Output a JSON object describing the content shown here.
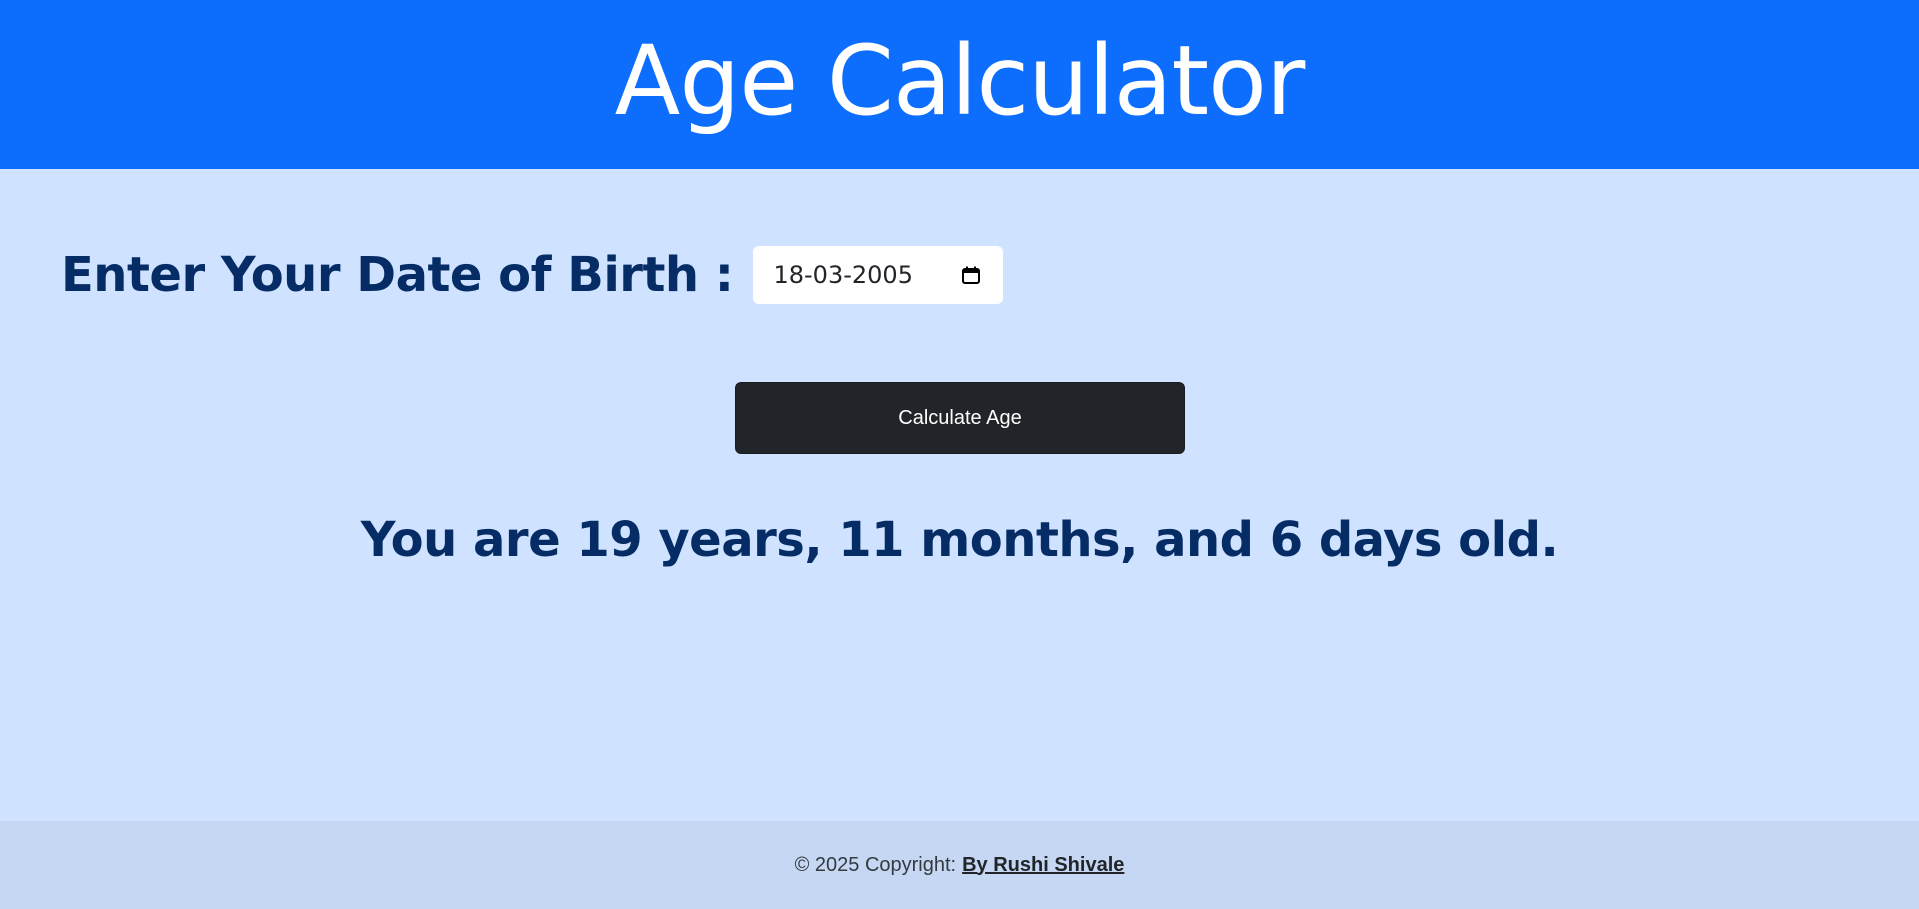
{
  "header": {
    "title": "Age Calculator"
  },
  "form": {
    "dob_label": "Enter Your Date of Birth :",
    "dob_value": "18-03-2005",
    "calendar_icon": "calendar-icon"
  },
  "action": {
    "calculate_label": "Calculate Age"
  },
  "result": {
    "text": "You are 19 years, 11 months, and 6 days old."
  },
  "footer": {
    "copyright": "© 2025 Copyright:",
    "author_link": "By Rushi Shivale"
  },
  "colors": {
    "header_bg": "#0d6efd",
    "page_bg": "#cfe2ff",
    "text_primary": "#052c65",
    "button_bg": "#212529",
    "footer_bg": "#c5d7f2"
  }
}
